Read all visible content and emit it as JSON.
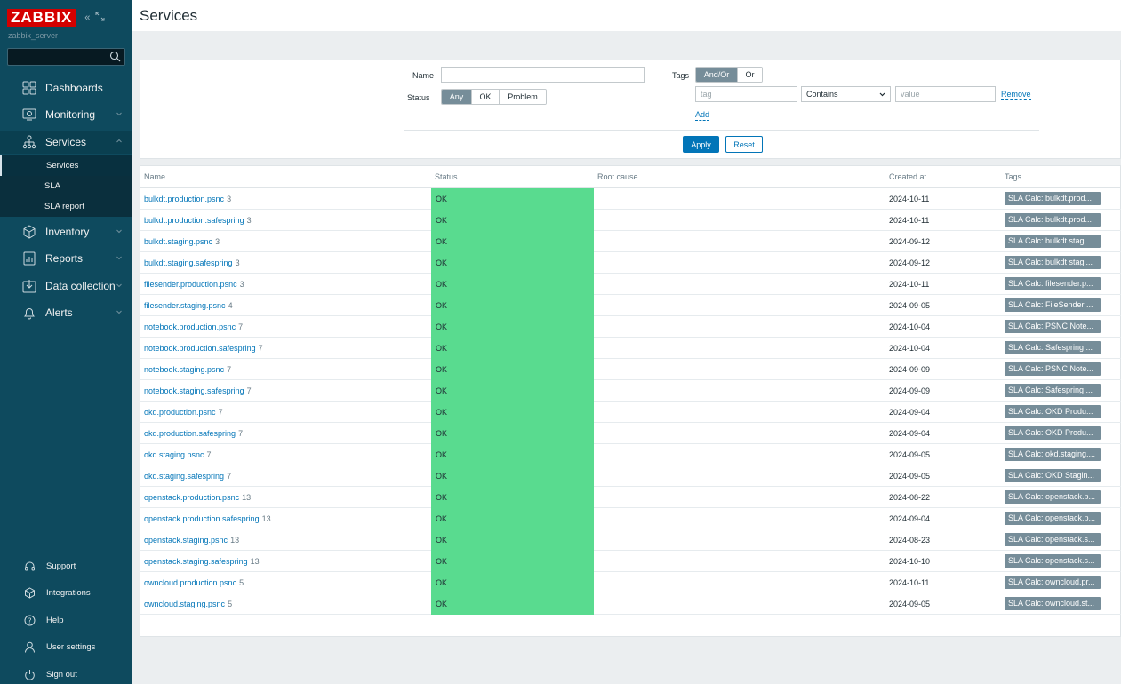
{
  "sidebar": {
    "logo": "ZABBIX",
    "server": "zabbix_server",
    "menu": {
      "dashboards": "Dashboards",
      "monitoring": "Monitoring",
      "services": "Services",
      "inventory": "Inventory",
      "reports": "Reports",
      "data_collection": "Data collection",
      "alerts": "Alerts"
    },
    "submenu": {
      "services": "Services",
      "sla": "SLA",
      "sla_report": "SLA report"
    },
    "bottom": {
      "support": "Support",
      "integrations": "Integrations",
      "help": "Help",
      "user_settings": "User settings",
      "sign_out": "Sign out"
    }
  },
  "header": {
    "title": "Services"
  },
  "filter": {
    "name_label": "Name",
    "name_value": "",
    "status_label": "Status",
    "status_options": [
      "Any",
      "OK",
      "Problem"
    ],
    "status_selected": "Any",
    "tags_label": "Tags",
    "tags_mode_options": [
      "And/Or",
      "Or"
    ],
    "tags_mode_selected": "And/Or",
    "tag_placeholder": "tag",
    "operator": "Contains",
    "value_placeholder": "value",
    "remove": "Remove",
    "add": "Add",
    "apply": "Apply",
    "reset": "Reset"
  },
  "table": {
    "headers": {
      "name": "Name",
      "status": "Status",
      "root_cause": "Root cause",
      "created_at": "Created at",
      "tags": "Tags"
    },
    "rows": [
      {
        "name": "bulkdt.production.psnc",
        "count": "3",
        "status": "OK",
        "created": "2024-10-11",
        "tag": "SLA Calc: bulkdt.prod..."
      },
      {
        "name": "bulkdt.production.safespring",
        "count": "3",
        "status": "OK",
        "created": "2024-10-11",
        "tag": "SLA Calc: bulkdt.prod..."
      },
      {
        "name": "bulkdt.staging.psnc",
        "count": "3",
        "status": "OK",
        "created": "2024-09-12",
        "tag": "SLA Calc: bulkdt stagi..."
      },
      {
        "name": "bulkdt.staging.safespring",
        "count": "3",
        "status": "OK",
        "created": "2024-09-12",
        "tag": "SLA Calc: bulkdt stagi..."
      },
      {
        "name": "filesender.production.psnc",
        "count": "3",
        "status": "OK",
        "created": "2024-10-11",
        "tag": "SLA Calc: filesender.p..."
      },
      {
        "name": "filesender.staging.psnc",
        "count": "4",
        "status": "OK",
        "created": "2024-09-05",
        "tag": "SLA Calc: FileSender ..."
      },
      {
        "name": "notebook.production.psnc",
        "count": "7",
        "status": "OK",
        "created": "2024-10-04",
        "tag": "SLA Calc: PSNC Note..."
      },
      {
        "name": "notebook.production.safespring",
        "count": "7",
        "status": "OK",
        "created": "2024-10-04",
        "tag": "SLA Calc: Safespring ..."
      },
      {
        "name": "notebook.staging.psnc",
        "count": "7",
        "status": "OK",
        "created": "2024-09-09",
        "tag": "SLA Calc: PSNC Note..."
      },
      {
        "name": "notebook.staging.safespring",
        "count": "7",
        "status": "OK",
        "created": "2024-09-09",
        "tag": "SLA Calc: Safespring ..."
      },
      {
        "name": "okd.production.psnc",
        "count": "7",
        "status": "OK",
        "created": "2024-09-04",
        "tag": "SLA Calc: OKD Produ..."
      },
      {
        "name": "okd.production.safespring",
        "count": "7",
        "status": "OK",
        "created": "2024-09-04",
        "tag": "SLA Calc: OKD Produ..."
      },
      {
        "name": "okd.staging.psnc",
        "count": "7",
        "status": "OK",
        "created": "2024-09-05",
        "tag": "SLA Calc: okd.staging...."
      },
      {
        "name": "okd.staging.safespring",
        "count": "7",
        "status": "OK",
        "created": "2024-09-05",
        "tag": "SLA Calc: OKD Stagin..."
      },
      {
        "name": "openstack.production.psnc",
        "count": "13",
        "status": "OK",
        "created": "2024-08-22",
        "tag": "SLA Calc: openstack.p..."
      },
      {
        "name": "openstack.production.safespring",
        "count": "13",
        "status": "OK",
        "created": "2024-09-04",
        "tag": "SLA Calc: openstack.p..."
      },
      {
        "name": "openstack.staging.psnc",
        "count": "13",
        "status": "OK",
        "created": "2024-08-23",
        "tag": "SLA Calc: openstack.s..."
      },
      {
        "name": "openstack.staging.safespring",
        "count": "13",
        "status": "OK",
        "created": "2024-10-10",
        "tag": "SLA Calc: openstack.s..."
      },
      {
        "name": "owncloud.production.psnc",
        "count": "5",
        "status": "OK",
        "created": "2024-10-11",
        "tag": "SLA Calc: owncloud.pr..."
      },
      {
        "name": "owncloud.staging.psnc",
        "count": "5",
        "status": "OK",
        "created": "2024-09-05",
        "tag": "SLA Calc: owncloud.st..."
      }
    ]
  },
  "colors": {
    "sidebar": "#0e4a5e",
    "logo": "#d40000",
    "ok": "#59db8f",
    "link": "#0275b8",
    "tag": "#768d99"
  }
}
